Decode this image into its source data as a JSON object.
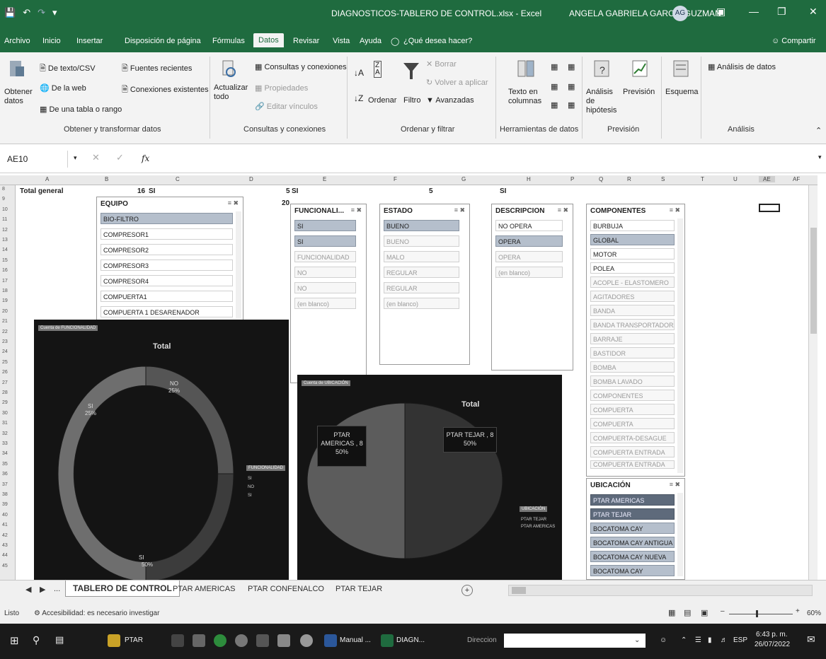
{
  "titlebar": {
    "save_icon": "save-icon",
    "undo_icon": "undo-icon",
    "redo_icon": "redo-icon",
    "title": "DIAGNOSTICOS-TABLERO DE CONTROL.xlsx  -  Excel",
    "user": "ANGELA GABRIELA GARCIA GUZMAN",
    "avatar": "AG"
  },
  "menu": {
    "archivo": "Archivo",
    "inicio": "Inicio",
    "insertar": "Insertar",
    "disposicion": "Disposición de página",
    "formulas": "Fórmulas",
    "datos": "Datos",
    "revisar": "Revisar",
    "vista": "Vista",
    "ayuda": "Ayuda",
    "search": "¿Qué desea hacer?",
    "compartir": "Compartir"
  },
  "ribbon": {
    "obtener": "Obtener datos",
    "texto_csv": "De texto/CSV",
    "web": "De la web",
    "tabla": "De una tabla o rango",
    "fuentes": "Fuentes recientes",
    "conexiones": "Conexiones existentes",
    "g1": "Obtener y transformar datos",
    "actualizar": "Actualizar todo",
    "consultas": "Consultas y conexiones",
    "propiedades": "Propiedades",
    "vinculos": "Editar vínculos",
    "g2": "Consultas y conexiones",
    "ordenar": "Ordenar",
    "filtro": "Filtro",
    "borrar": "Borrar",
    "volver": "Volver a aplicar",
    "avanzadas": "Avanzadas",
    "g3": "Ordenar y filtrar",
    "texto_col": "Texto en columnas",
    "g4": "Herramientas de datos",
    "analisis_hip": "Análisis de hipótesis",
    "prevision": "Previsión",
    "g5": "Previsión",
    "esquema": "Esquema",
    "analisis_datos": "Análisis de datos",
    "g6": "Análisis"
  },
  "formula": {
    "namebox": "AE10",
    "fx": "fx",
    "value": ""
  },
  "columns": [
    "A",
    "B",
    "C",
    "D",
    "E",
    "F",
    "G",
    "H",
    "P",
    "Q",
    "R",
    "S",
    "T",
    "U",
    "AE",
    "AF"
  ],
  "rows": [
    "8",
    "9",
    "10",
    "11",
    "12",
    "13",
    "14",
    "15",
    "16",
    "17",
    "18",
    "19",
    "20",
    "21",
    "22",
    "23",
    "24",
    "25",
    "26",
    "27",
    "28",
    "29",
    "30",
    "31",
    "32",
    "33",
    "34",
    "35",
    "36",
    "37",
    "38",
    "39",
    "40",
    "41",
    "42",
    "43",
    "44",
    "45"
  ],
  "cells": {
    "total_general": "Total general",
    "c1": "16",
    "c2": "SI",
    "c3": "5",
    "c4": "SI",
    "c5": "20",
    "c6": "5",
    "c7": "SI"
  },
  "slicers": {
    "equipo": {
      "title": "EQUIPO",
      "items": [
        "BIO-FILTRO",
        "COMPRESOR1",
        "COMPRESOR2",
        "COMPRESOR3",
        "COMPRESOR4",
        "COMPUERTA1",
        "COMPUERTA 1 DESARENADOR"
      ]
    },
    "funcionalidad": {
      "title": "FUNCIONALI...",
      "items": [
        "SI",
        "SI",
        "FUNCIONALIDAD",
        "NO",
        "NO",
        "(en blanco)"
      ]
    },
    "estado": {
      "title": "ESTADO",
      "items": [
        "BUENO",
        "BUENO",
        "MALO",
        "REGULAR",
        "REGULAR",
        "(en blanco)"
      ]
    },
    "descripcion": {
      "title": "DESCRIPCION",
      "items": [
        "NO OPERA",
        "OPERA",
        "OPERA",
        "(en blanco)"
      ]
    },
    "componentes": {
      "title": "COMPONENTES",
      "items": [
        "BURBUJA",
        "GLOBAL",
        "MOTOR",
        "POLEA",
        "ACOPLE - ELASTOMERO",
        "AGITADORES",
        "BANDA",
        "BANDA TRANSPORTADORA",
        "BARRAJE",
        "BASTIDOR",
        "BOMBA",
        "BOMBA LAVADO",
        "COMPONENTES",
        "COMPUERTA",
        "COMPUERTA",
        "COMPUERTA-DESAGUE",
        "COMPUERTA ENTRADA",
        "COMPUERTA ENTRADA"
      ]
    },
    "ubicacion": {
      "title": "UBICACIÓN",
      "items": [
        "PTAR AMERICAS",
        "PTAR TEJAR",
        "BOCATOMA CAY",
        "BOCATOMA CAY ANTIGUA",
        "BOCATOMA CAY NUEVA",
        "BOCATOMA CAY"
      ]
    }
  },
  "chart_data": [
    {
      "type": "pie",
      "title": "Total",
      "subtype": "doughnut",
      "field_button": "Cuenta de FUNCIONALIDAD",
      "legend": "right",
      "categories": [
        "SI",
        "NO",
        "SI"
      ],
      "values": [
        25,
        25,
        50
      ],
      "labels": [
        "SI 25%",
        "NO 25%",
        "SI 50%"
      ],
      "colors": [
        "#555555",
        "#3c3c3c",
        "#6e6e6e"
      ]
    },
    {
      "type": "pie",
      "title": "Total",
      "field_button": "Cuenta de UBICACIÓN",
      "legend": "bottom-right",
      "categories": [
        "PTAR AMERICAS",
        "PTAR TEJAR"
      ],
      "values": [
        8,
        8
      ],
      "labels": [
        "PTAR AMERICAS, 8 50%",
        "PTAR TEJAR, 8 50%"
      ],
      "colors": [
        "#333333",
        "#5c5c5c"
      ]
    }
  ],
  "chart_labels": {
    "c1_title": "Total",
    "c1_btn": "Cuenta de FUNCIONALIDAD",
    "c1_l1a": "SI",
    "c1_l1b": "25%",
    "c1_l2a": "NO",
    "c1_l2b": "25%",
    "c1_l3a": "SI",
    "c1_l3b": "50%",
    "c1_leg": "FUNCIONALIDAD",
    "c1_leg1": "SI",
    "c1_leg2": "NO",
    "c1_leg3": "SI",
    "c2_title": "Total",
    "c2_btn": "Cuenta de UBICACIÓN",
    "c2_l1a": "PTAR",
    "c2_l1b": "AMERICAS , 8",
    "c2_l1c": "50%",
    "c2_l2a": "PTAR TEJAR , 8",
    "c2_l2b": "50%",
    "c2_leg": "UBICACIÓN",
    "c2_leg1": "PTAR TEJAR",
    "c2_leg2": "PTAR AMERICAS"
  },
  "tabs": {
    "ellipsis": "...",
    "t1": "TABLERO DE CONTROL",
    "t2": "PTAR AMERICAS",
    "t3": "PTAR CONFENALCO",
    "t4": "PTAR TEJAR",
    "add": "+"
  },
  "status": {
    "listo": "Listo",
    "access": "Accesibilidad: es necesario investigar",
    "zoom": "60%"
  },
  "taskbar": {
    "t1": "PTAR",
    "t2": "Manual ...",
    "t3": "DIAGN...",
    "search": "Direccion",
    "lang": "ESP",
    "time": "6:43 p. m.",
    "date": "26/07/2022"
  }
}
